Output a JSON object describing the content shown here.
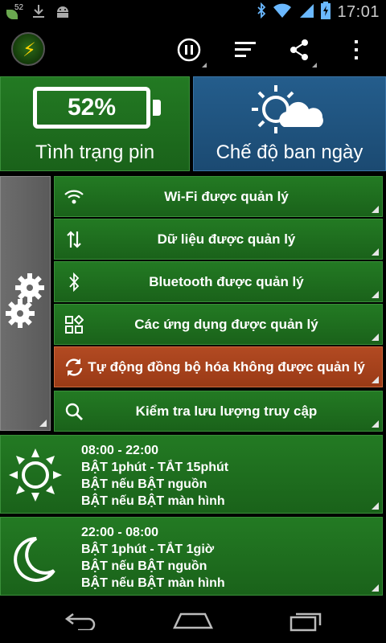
{
  "status_bar": {
    "notification_count": "52",
    "time": "17:01",
    "icons": [
      "download-icon",
      "android-icon",
      "bluetooth-icon",
      "wifi-icon",
      "signal-icon",
      "battery-charging-icon"
    ]
  },
  "action_bar": {
    "logo_icon": "lightning-power-icon",
    "buttons": [
      "pause-icon",
      "sort-icon",
      "share-icon",
      "overflow-menu-icon"
    ]
  },
  "battery": {
    "percent_text": "52%",
    "level": 52,
    "label": "Tình trạng pin"
  },
  "mode": {
    "label": "Chế độ ban ngày",
    "icon": "sun-cloud-icon"
  },
  "settings_tile": {
    "icon": "gears-icon"
  },
  "controls": [
    {
      "label": "Wi-Fi được quản lý",
      "icon": "wifi-icon",
      "color": "#1e6e1e"
    },
    {
      "label": "Dữ liệu được quản lý",
      "icon": "data-arrows-icon",
      "color": "#1e6e1e"
    },
    {
      "label": "Bluetooth được quản lý",
      "icon": "bluetooth-icon",
      "color": "#1e6e1e"
    },
    {
      "label": "Các ứng dụng được quản lý",
      "icon": "apps-icon",
      "color": "#1e6e1e"
    },
    {
      "label": "Tự động đồng bộ hóa không được quản lý",
      "icon": "sync-icon",
      "color": "#a8431c"
    },
    {
      "label": "Kiểm tra lưu lượng truy cập",
      "icon": "search-icon",
      "color": "#1e6e1e"
    }
  ],
  "day_schedule": {
    "icon": "sun-icon",
    "lines": [
      "08:00 - 22:00",
      "BẬT 1phút - TẮT 15phút",
      "BẬT nếu BẬT nguồn",
      "BẬT nếu BẬT màn hình"
    ]
  },
  "night_schedule": {
    "icon": "moon-icon",
    "lines": [
      "22:00 - 08:00",
      "BẬT 1phút - TẮT 1giờ",
      "BẬT nếu BẬT nguồn",
      "BẬT nếu BẬT màn hình"
    ]
  },
  "nav_bar": {
    "buttons": [
      "back-icon",
      "home-icon",
      "recents-icon"
    ]
  }
}
